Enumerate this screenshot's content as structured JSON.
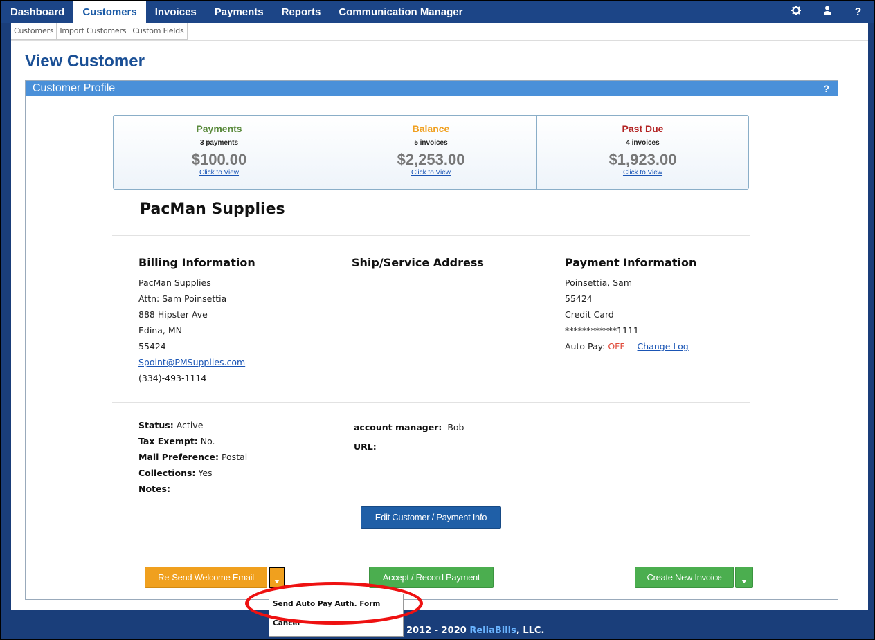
{
  "nav": {
    "tabs": [
      {
        "label": "Dashboard"
      },
      {
        "label": "Customers"
      },
      {
        "label": "Invoices"
      },
      {
        "label": "Payments"
      },
      {
        "label": "Reports"
      },
      {
        "label": "Communication Manager"
      }
    ],
    "icons": [
      "gear-icon",
      "user-icon",
      "help-icon"
    ],
    "help_glyph": "?"
  },
  "subnav": [
    "Customers",
    "Import Customers",
    "Custom Fields"
  ],
  "page_title": "View Customer",
  "panel": {
    "title": "Customer Profile",
    "help": "?"
  },
  "summary": [
    {
      "label": "Payments",
      "sub": "3 payments",
      "amount": "$100.00",
      "link": "Click to View",
      "color": "#5a8a3c"
    },
    {
      "label": "Balance",
      "sub": "5 invoices",
      "amount": "$2,253.00",
      "link": "Click to View",
      "color": "#f0a020"
    },
    {
      "label": "Past Due",
      "sub": "4 invoices",
      "amount": "$1,923.00",
      "link": "Click to View",
      "color": "#b22222"
    }
  ],
  "customer_name": "PacMan Supplies",
  "billing": {
    "heading": "Billing Information",
    "lines": [
      "PacMan Supplies",
      "Attn: Sam Poinsettia",
      "888 Hipster Ave",
      "Edina, MN",
      "55424"
    ],
    "email": "Spoint@PMSupplies.com",
    "phone": "(334)-493-1114"
  },
  "shipping": {
    "heading": "Ship/Service Address"
  },
  "payment_info": {
    "heading": "Payment Information",
    "lines": [
      "Poinsettia, Sam",
      "55424",
      "Credit Card",
      "************1111"
    ],
    "autopay_label": "Auto Pay:",
    "autopay_value": "OFF",
    "change_log": "Change Log"
  },
  "meta_left": [
    {
      "key": "Status:",
      "value": "Active"
    },
    {
      "key": "Tax Exempt:",
      "value": "No."
    },
    {
      "key": "Mail Preference:",
      "value": "Postal"
    },
    {
      "key": "Collections:",
      "value": "Yes"
    },
    {
      "key": "Notes:",
      "value": ""
    }
  ],
  "meta_right": [
    {
      "key": "account manager:",
      "value": "Bob"
    },
    {
      "key": "URL:",
      "value": ""
    }
  ],
  "buttons": {
    "edit": "Edit Customer / Payment Info",
    "resend": "Re-Send Welcome Email",
    "accept": "Accept / Record Payment",
    "create": "Create New Invoice"
  },
  "dropdown": [
    "Send Auto Pay Auth. Form",
    "Cancel"
  ],
  "footer": {
    "text": "2012 - 2020 ",
    "brand": "ReliaBills",
    "suffix": ", LLC."
  },
  "colors": {
    "nav": "#1c4587",
    "accent": "#4a90d9",
    "orange": "#f0a01e",
    "green": "#4bae4f",
    "highlight": "#e11111"
  }
}
